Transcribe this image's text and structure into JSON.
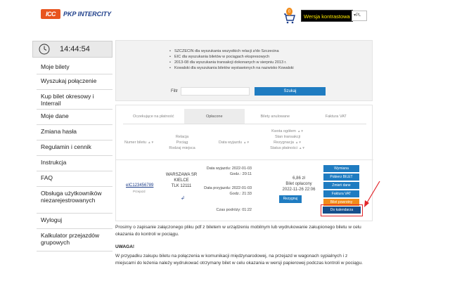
{
  "header": {
    "logo_mark": "ICC",
    "logo_text": "PKP INTERCITY",
    "cart_count": "0",
    "contrast_label": "Wersja kontrastowa",
    "lang": "PL"
  },
  "clock": {
    "time": "14:44:54"
  },
  "sidebar": {
    "items": [
      {
        "label": "Moje bilety"
      },
      {
        "label": "Wyszukaj połączenie"
      },
      {
        "label": "Kup bilet okresowy i Interrail"
      },
      {
        "label": "Moje dane"
      },
      {
        "label": "Zmiana hasła"
      },
      {
        "label": "Regulamin i cennik"
      },
      {
        "label": "Instrukcja"
      },
      {
        "label": "FAQ"
      },
      {
        "label": "Obsługa użytkowników niezarejestrowanych"
      },
      {
        "label": "Wyloguj"
      },
      {
        "label": "Kalkulator przejazdów grupowych"
      }
    ]
  },
  "search": {
    "hints": [
      "SZCZECIN dla wyszukania wszystkich relacji z/do Szczecina",
      "EIC dla wyszukania biletów w pociągach ekspresowych",
      "2013-08 dla wyszukania transakcji dokonanych w sierpniu 2013 r.",
      "Kowalski dla wyszukania biletów wystawionych na nazwisko Kowalski"
    ],
    "filter_label": "Filtr",
    "search_button": "Szukaj"
  },
  "tabs": [
    {
      "label": "Oczekujące na płatność"
    },
    {
      "label": "Opłacone"
    },
    {
      "label": "Bilety anulowane"
    },
    {
      "label": "Faktura VAT"
    }
  ],
  "columns": {
    "ticket_no": "Numer biletu",
    "route_l1": "Relacja",
    "route_l2": "Pociąg",
    "route_l3": "Rodzaj miejsca",
    "date": "Data wyjazdu",
    "price_l1": "Kwota ogółem",
    "price_l2": "Stan transakcji",
    "price_l3": "Rezygnacja",
    "price_l4": "Status płatności"
  },
  "ticket": {
    "number": "eIC123456789",
    "sub": "Przejazd",
    "from": "WARSZAWA SR",
    "to": "KIELCE",
    "train": "TLK 12111",
    "dep_date": "Data wyjazdu: 2022-01-03",
    "dep_time": "Godz.: 20:11",
    "arr_date": "Data przyjazdu: 2022-01-03",
    "arr_time": "Godz.: 21:33",
    "duration": "Czas podróży: 01:22",
    "price": "6,86 zł",
    "status": "Bilet opłacony",
    "paid_at": "2022-11-26 22:06",
    "reserve_button": "Rezygnuj"
  },
  "actions": [
    {
      "label": "Wymiana",
      "style": "blue"
    },
    {
      "label": "Pobierz BILET",
      "style": "blue"
    },
    {
      "label": "Zmień dane",
      "style": "blue"
    },
    {
      "label": "Faktura VAT",
      "style": "blue"
    },
    {
      "label": "Bilet powrotny",
      "style": "orange"
    }
  ],
  "calendar_button": "Do kalendarza",
  "notes": {
    "text1": "Prosimy o zapisanie załączonego pliku pdf z biletem w urządzeniu mobilnym lub wydrukowanie zakupionego biletu w celu okazania do kontroli w pociągu.",
    "uwaga": "UWAGA!",
    "text2": "W przypadku zakupu biletu na połączenia w komunikacji międzynarodowej, na przejazd w wagonach sypialnych i z miejscami do leżenia należy wydrukować otrzymany bilet w celu okazania w wersji papierowej podczas kontroli w pociągu."
  },
  "colors": {
    "accent": "#1f7cc1",
    "dark_accent": "#174f8c",
    "orange": "#f28c1a",
    "highlight": "#e3262b"
  }
}
